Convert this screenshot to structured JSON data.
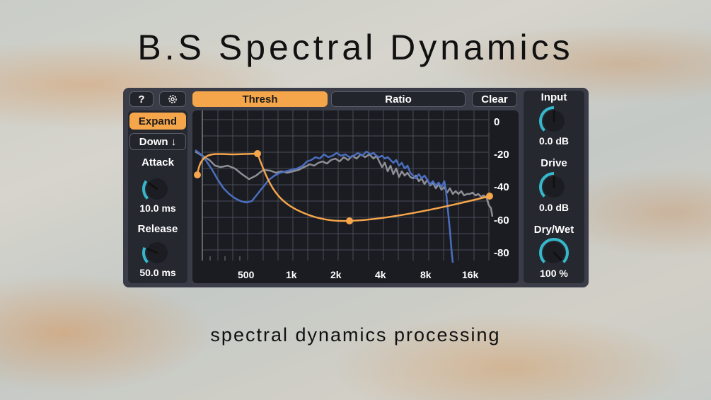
{
  "title": "B.S Spectral Dynamics",
  "subtitle": "spectral dynamics processing",
  "toolbar": {
    "help_label": "?",
    "settings_icon": "gear-icon",
    "tabs": [
      {
        "label": "Thresh",
        "active": true
      },
      {
        "label": "Ratio",
        "active": false
      }
    ],
    "clear_label": "Clear"
  },
  "left": {
    "mode_label": "Expand",
    "direction_label": "Down ↓",
    "attack": {
      "label": "Attack",
      "value": "10.0 ms",
      "level": 0.3
    },
    "release": {
      "label": "Release",
      "value": "50.0 ms",
      "level": 0.25
    }
  },
  "right": {
    "input": {
      "label": "Input",
      "value": "0.0 dB",
      "level": 0.5
    },
    "drive": {
      "label": "Drive",
      "value": "0.0 dB",
      "level": 0.5
    },
    "drywet": {
      "label": "Dry/Wet",
      "value": "100 %",
      "level": 1.0
    }
  },
  "graph": {
    "y_labels": [
      "0",
      "-20",
      "-40",
      "-60",
      "-80"
    ],
    "x_labels": [
      "500",
      "1k",
      "2k",
      "4k",
      "8k",
      "16k"
    ]
  },
  "colors": {
    "accent": "#f5a54a",
    "knob_arc": "#35b8cc",
    "spectrum_in": "#4a6fc0",
    "spectrum_out": "#8e8e96"
  }
}
